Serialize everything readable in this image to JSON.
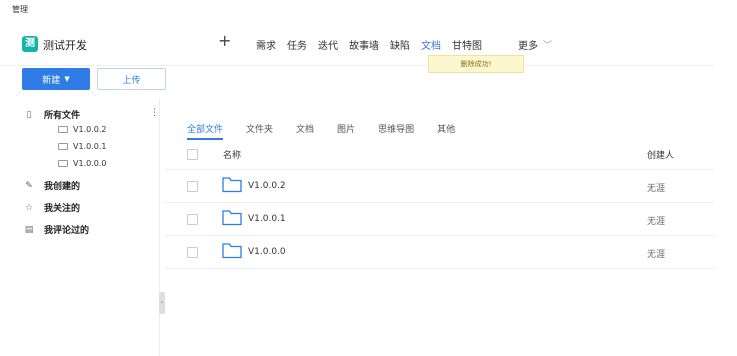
{
  "top_strip": {
    "label": "管理"
  },
  "header": {
    "logo_char": "测",
    "project_name": "测试开发",
    "plus": "+",
    "nav": [
      {
        "label": "需求",
        "active": false
      },
      {
        "label": "任务",
        "active": false
      },
      {
        "label": "迭代",
        "active": false
      },
      {
        "label": "故事墙",
        "active": false
      },
      {
        "label": "缺陷",
        "active": false
      },
      {
        "label": "文档",
        "active": true
      },
      {
        "label": "甘特图",
        "active": false
      }
    ],
    "more_label": "更多"
  },
  "toast": {
    "message": "删除成功!"
  },
  "actions": {
    "new_label": "新建",
    "upload_label": "上传"
  },
  "sidebar": {
    "all_files": "所有文件",
    "versions": [
      "V1.0.0.2",
      "V1.0.0.1",
      "V1.0.0.0"
    ],
    "created_by_me": "我创建的",
    "followed_by_me": "我关注的",
    "commented_by_me": "我评论过的"
  },
  "tabs": [
    {
      "label": "全部文件",
      "active": true
    },
    {
      "label": "文件夹",
      "active": false
    },
    {
      "label": "文档",
      "active": false
    },
    {
      "label": "图片",
      "active": false
    },
    {
      "label": "思维导图",
      "active": false
    },
    {
      "label": "其他",
      "active": false
    }
  ],
  "table": {
    "headers": {
      "name": "名称",
      "creator": "创建人"
    },
    "rows": [
      {
        "name": "V1.0.0.2",
        "creator": "无涯"
      },
      {
        "name": "V1.0.0.1",
        "creator": "无涯"
      },
      {
        "name": "V1.0.0.0",
        "creator": "无涯"
      }
    ]
  },
  "colors": {
    "accent": "#2f7ce6",
    "logo": "#13b5a6",
    "toast_bg": "#fdf7cf"
  }
}
